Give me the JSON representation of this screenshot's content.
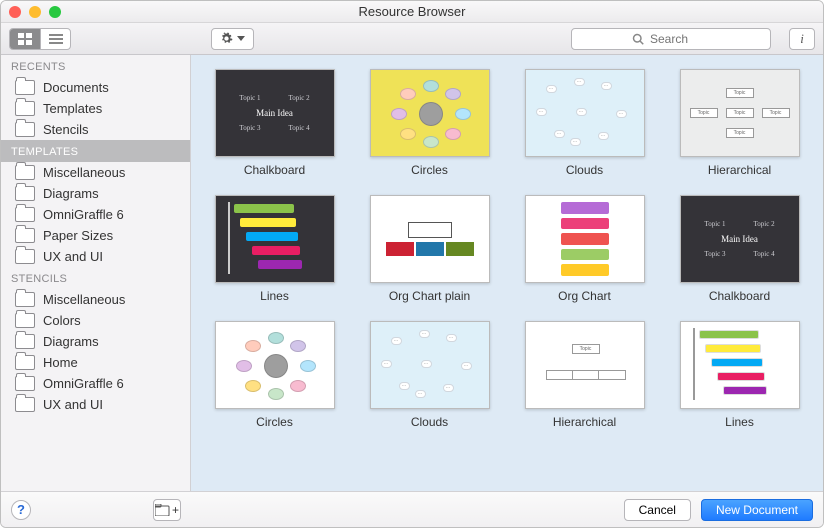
{
  "window": {
    "title": "Resource Browser"
  },
  "traffic": {
    "close": "#ff5f57",
    "min": "#febc2e",
    "max": "#28c840"
  },
  "search": {
    "placeholder": "Search"
  },
  "sidebar": {
    "sections": [
      {
        "header": "RECENTS",
        "strong": false,
        "items": [
          {
            "label": "Documents"
          },
          {
            "label": "Templates"
          },
          {
            "label": "Stencils"
          }
        ]
      },
      {
        "header": "TEMPLATES",
        "strong": true,
        "items": [
          {
            "label": "Miscellaneous"
          },
          {
            "label": "Diagrams"
          },
          {
            "label": "OmniGraffle 6"
          },
          {
            "label": "Paper Sizes"
          },
          {
            "label": "UX and UI"
          }
        ]
      },
      {
        "header": "STENCILS",
        "strong": false,
        "items": [
          {
            "label": "Miscellaneous"
          },
          {
            "label": "Colors"
          },
          {
            "label": "Diagrams"
          },
          {
            "label": "Home"
          },
          {
            "label": "OmniGraffle 6"
          },
          {
            "label": "UX and UI"
          }
        ]
      }
    ]
  },
  "tiles": [
    {
      "label": "Chalkboard",
      "kind": "chalkboard"
    },
    {
      "label": "Circles",
      "kind": "circles-y"
    },
    {
      "label": "Clouds",
      "kind": "clouds"
    },
    {
      "label": "Hierarchical",
      "kind": "hier"
    },
    {
      "label": "Lines",
      "kind": "lines-dark"
    },
    {
      "label": "Org Chart plain",
      "kind": "orgplain"
    },
    {
      "label": "Org Chart",
      "kind": "orgcol"
    },
    {
      "label": "Chalkboard",
      "kind": "chalkboard"
    },
    {
      "label": "Circles",
      "kind": "circles-w"
    },
    {
      "label": "Clouds",
      "kind": "clouds"
    },
    {
      "label": "Hierarchical",
      "kind": "hier2"
    },
    {
      "label": "Lines",
      "kind": "lines-white"
    }
  ],
  "chalk": {
    "t1": "Topic 1",
    "t2": "Topic 2",
    "t3": "Topic 3",
    "t4": "Topic 4",
    "main": "Main Idea"
  },
  "footer": {
    "cancel": "Cancel",
    "new": "New Document"
  }
}
